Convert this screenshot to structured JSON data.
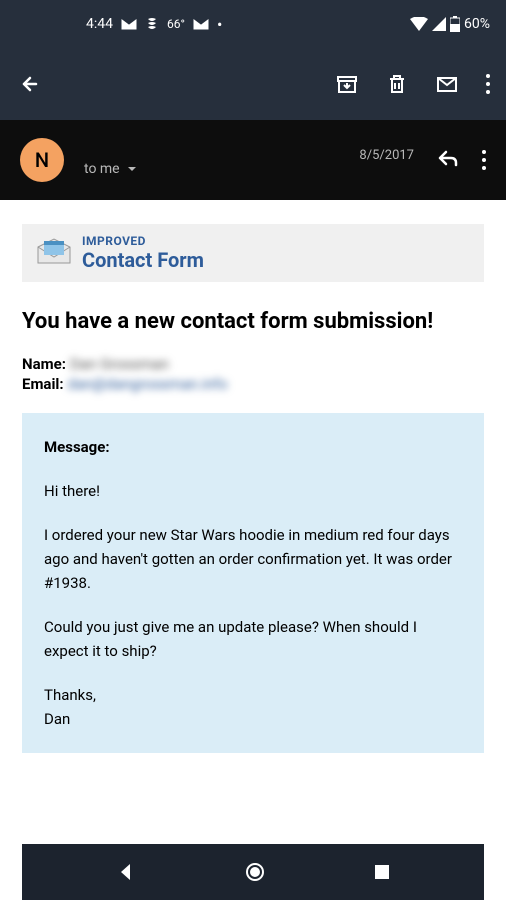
{
  "status": {
    "time": "4:44",
    "temp": "66°",
    "battery": "60%"
  },
  "email": {
    "avatar_letter": "N",
    "recipient": "to me",
    "date": "8/5/2017"
  },
  "banner": {
    "line1": "IMPROVED",
    "line2": "Contact Form"
  },
  "subject": "You have a new contact form submission!",
  "meta": {
    "name_label": "Name:",
    "name_value": "Dan Grossman",
    "email_label": "Email:",
    "email_value": "dan@dangrossman.info"
  },
  "message": {
    "label": "Message:",
    "p1": "Hi there!",
    "p2": "I ordered your new Star Wars hoodie in medium red four days ago and haven't gotten an order confirmation yet. It was order #1938.",
    "p3": "Could you just give me an update please? When should I expect it to ship?",
    "p4": "Thanks,",
    "p5": "Dan"
  }
}
